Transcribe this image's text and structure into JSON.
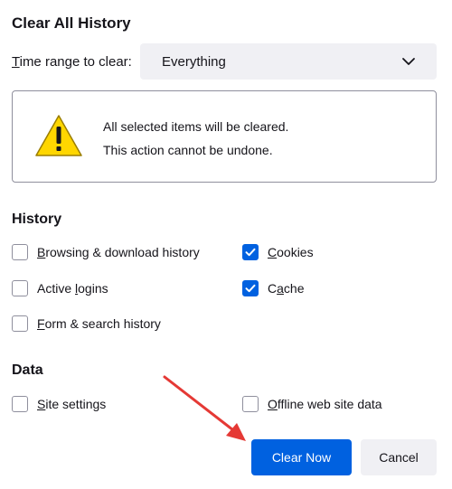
{
  "dialog": {
    "title": "Clear All History"
  },
  "time_range": {
    "label_accesskey": "T",
    "label_rest": "ime range to clear:",
    "selected": "Everything"
  },
  "warning": {
    "line1": "All selected items will be cleared.",
    "line2": "This action cannot be undone."
  },
  "history": {
    "heading": "History",
    "items": [
      {
        "accesskey": "B",
        "rest": "rowsing & download history",
        "checked": false
      },
      {
        "accesskey": "C",
        "rest": "ookies",
        "checked": true
      },
      {
        "pre": "Active ",
        "accesskey": "l",
        "rest": "ogins",
        "checked": false
      },
      {
        "pre": "C",
        "accesskey": "a",
        "rest": "che",
        "checked": true
      },
      {
        "accesskey": "F",
        "rest": "orm & search history",
        "checked": false
      }
    ]
  },
  "data": {
    "heading": "Data",
    "items": [
      {
        "accesskey": "S",
        "rest": "ite settings",
        "checked": false
      },
      {
        "accesskey": "O",
        "rest": "ffline web site data",
        "checked": false
      }
    ]
  },
  "buttons": {
    "clear_now": "Clear Now",
    "cancel": "Cancel"
  },
  "colors": {
    "accent": "#0061e0",
    "annotation_arrow": "#e53935",
    "warning_yellow": "#ffd600"
  }
}
